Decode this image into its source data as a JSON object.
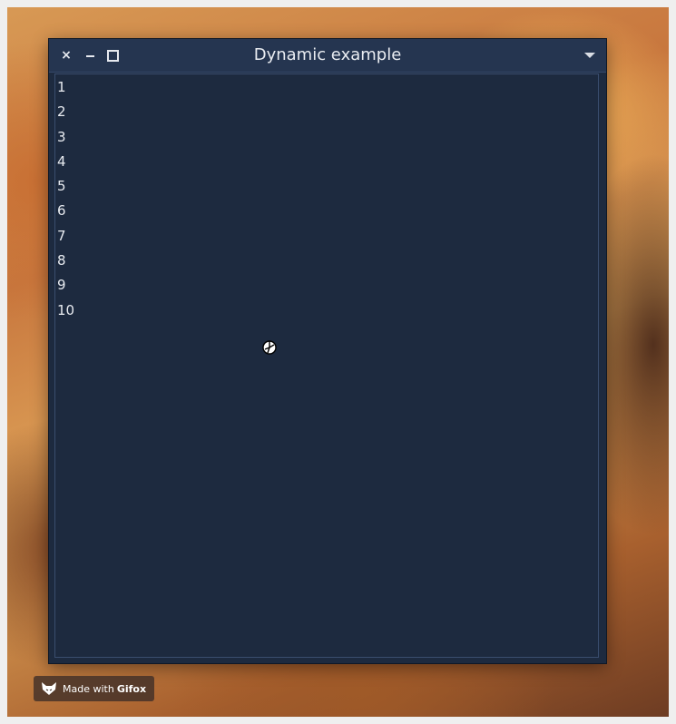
{
  "window": {
    "title": "Dynamic example",
    "close_glyph": "×",
    "menu_icon": "chevron-down-icon"
  },
  "list": {
    "items": [
      "1",
      "2",
      "3",
      "4",
      "5",
      "6",
      "7",
      "8",
      "9",
      "10"
    ]
  },
  "badge": {
    "prefix": "Made with",
    "brand": "Gifox"
  },
  "colors": {
    "window_bg": "#1d2a3f",
    "titlebar_bg": "#253550",
    "text": "#e8ebf0"
  }
}
